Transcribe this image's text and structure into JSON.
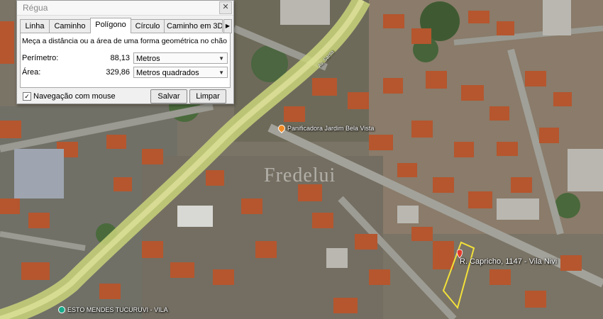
{
  "ruler": {
    "title": "Régua",
    "close_icon": "close-icon",
    "tabs": [
      {
        "label": "Linha",
        "active": false
      },
      {
        "label": "Caminho",
        "active": false
      },
      {
        "label": "Polígono",
        "active": true
      },
      {
        "label": "Círculo",
        "active": false
      },
      {
        "label": "Caminho em 3D",
        "active": false
      }
    ],
    "tab_scroll_icon": "chevron-right-icon",
    "description": "Meça a distância ou a área de uma forma geométrica no chão",
    "perimeter": {
      "label": "Perímetro:",
      "value": "88,13",
      "unit": "Metros"
    },
    "area": {
      "label": "Área:",
      "value": "329,86",
      "unit": "Metros quadrados"
    },
    "mouse_navigation": {
      "label": "Navegação com mouse",
      "checked": true
    },
    "save_label": "Salvar",
    "clear_label": "Limpar"
  },
  "map": {
    "place_label": "Panificadora Jardim Bela Vista",
    "road_label": "Av. Santa",
    "address_label": "R. Capricho, 1147 - Vila Nivi",
    "watermark": "Fredelui",
    "bottom_label": "ESTO MENDES TUCURUVI - VILA"
  }
}
